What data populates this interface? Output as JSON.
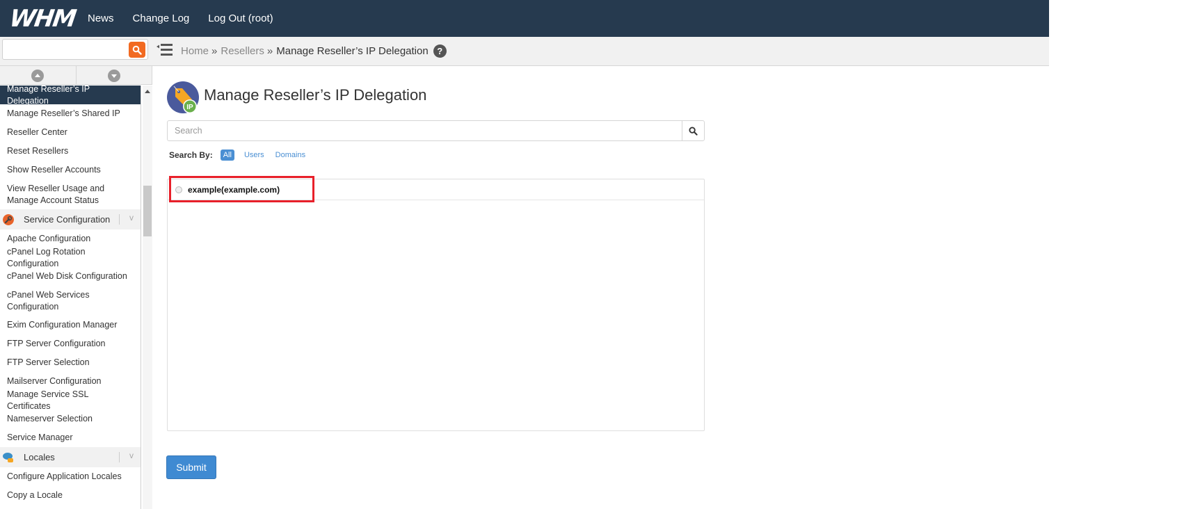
{
  "header": {
    "logo_text": "WHM",
    "nav": [
      {
        "label": "News"
      },
      {
        "label": "Change Log"
      },
      {
        "label": "Log Out (root)"
      }
    ]
  },
  "quick_search": {
    "placeholder": "",
    "value": "",
    "button_icon": "search-icon"
  },
  "breadcrumb": {
    "items": [
      {
        "label": "Home"
      },
      {
        "label": "Resellers"
      }
    ],
    "separator": "»",
    "current": "Manage Reseller’s IP Delegation",
    "help_label": "?"
  },
  "sidebar": {
    "items_top": [
      {
        "label": "Manage Reseller’s IP Delegation",
        "active": true
      },
      {
        "label": "Manage Reseller’s Shared IP"
      },
      {
        "label": "Reseller Center"
      },
      {
        "label": "Reset Resellers"
      },
      {
        "label": "Show Reseller Accounts"
      },
      {
        "label": "View Reseller Usage and Manage Account Status"
      }
    ],
    "category_service": {
      "label": "Service Configuration",
      "icon": "wrench-icon",
      "chevron": "v"
    },
    "items_service": [
      {
        "label": "Apache Configuration"
      },
      {
        "label": "cPanel Log Rotation Configuration"
      },
      {
        "label": "cPanel Web Disk Configuration"
      },
      {
        "label": "cPanel Web Services Configuration"
      },
      {
        "label": "Exim Configuration Manager"
      },
      {
        "label": "FTP Server Configuration"
      },
      {
        "label": "FTP Server Selection"
      },
      {
        "label": "Mailserver Configuration"
      },
      {
        "label": "Manage Service SSL Certificates"
      },
      {
        "label": "Nameserver Selection"
      },
      {
        "label": "Service Manager"
      }
    ],
    "category_locales": {
      "label": "Locales",
      "icon": "speech-bubbles-icon",
      "chevron": "v"
    },
    "items_locales": [
      {
        "label": "Configure Application Locales"
      },
      {
        "label": "Copy a Locale"
      }
    ]
  },
  "main": {
    "title": "Manage Reseller’s IP Delegation",
    "title_icon_badge": "IP",
    "search": {
      "placeholder": "Search",
      "value": ""
    },
    "search_by": {
      "label": "Search By:",
      "options": [
        {
          "label": "All",
          "active": true
        },
        {
          "label": "Users"
        },
        {
          "label": "Domains"
        }
      ]
    },
    "resellers": [
      {
        "label": "example(example.com)",
        "selected": false
      }
    ],
    "submit_label": "Submit"
  },
  "colors": {
    "header_bg": "#263a4f",
    "accent_orange": "#f26a21",
    "primary_blue": "#3f8ad2",
    "highlight_red": "#e8202a"
  }
}
